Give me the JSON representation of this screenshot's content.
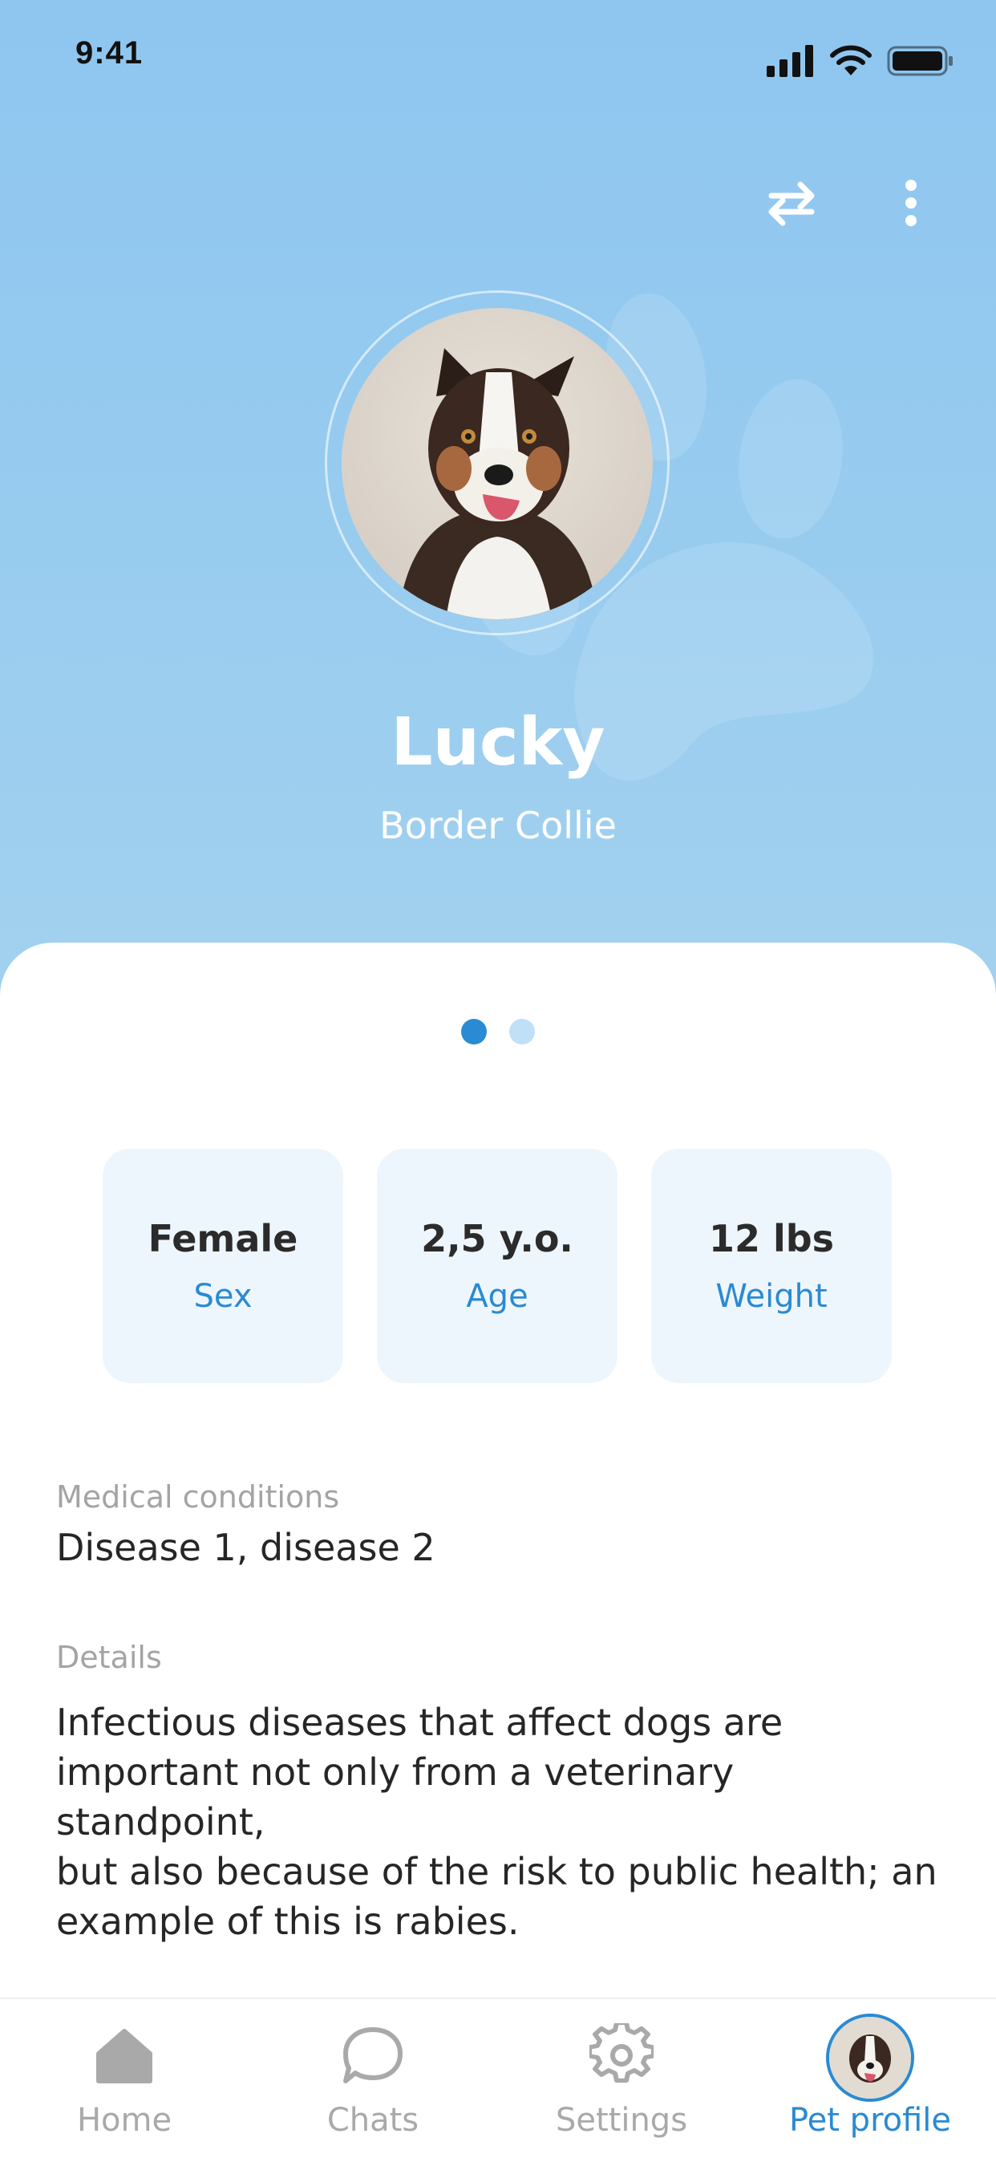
{
  "status_bar": {
    "time": "9:41"
  },
  "header": {
    "swap_icon": "swap-arrows-icon",
    "more_icon": "more-vertical-icon",
    "pet_name": "Lucky",
    "pet_breed": "Border Collie",
    "accent_color": "#2a8ad3"
  },
  "pager": {
    "current": 1,
    "total": 2
  },
  "stats": [
    {
      "value": "Female",
      "label": "Sex"
    },
    {
      "value": "2,5 y.o.",
      "label": "Age"
    },
    {
      "value": "12 lbs",
      "label": "Weight"
    }
  ],
  "medical": {
    "label": "Medical conditions",
    "value": "Disease 1, disease 2"
  },
  "details": {
    "label": "Details",
    "lines": [
      "Infectious diseases that affect dogs are",
      "important not only from a veterinary standpoint,",
      "but also because of the risk to public health; an",
      "example of this is rabies."
    ]
  },
  "tabbar": {
    "items": [
      {
        "label": "Home",
        "icon": "home-icon"
      },
      {
        "label": "Chats",
        "icon": "chat-bubble-icon"
      },
      {
        "label": "Settings",
        "icon": "gear-icon"
      },
      {
        "label": "Pet profile",
        "icon": "pet-avatar"
      }
    ],
    "active": 3
  }
}
